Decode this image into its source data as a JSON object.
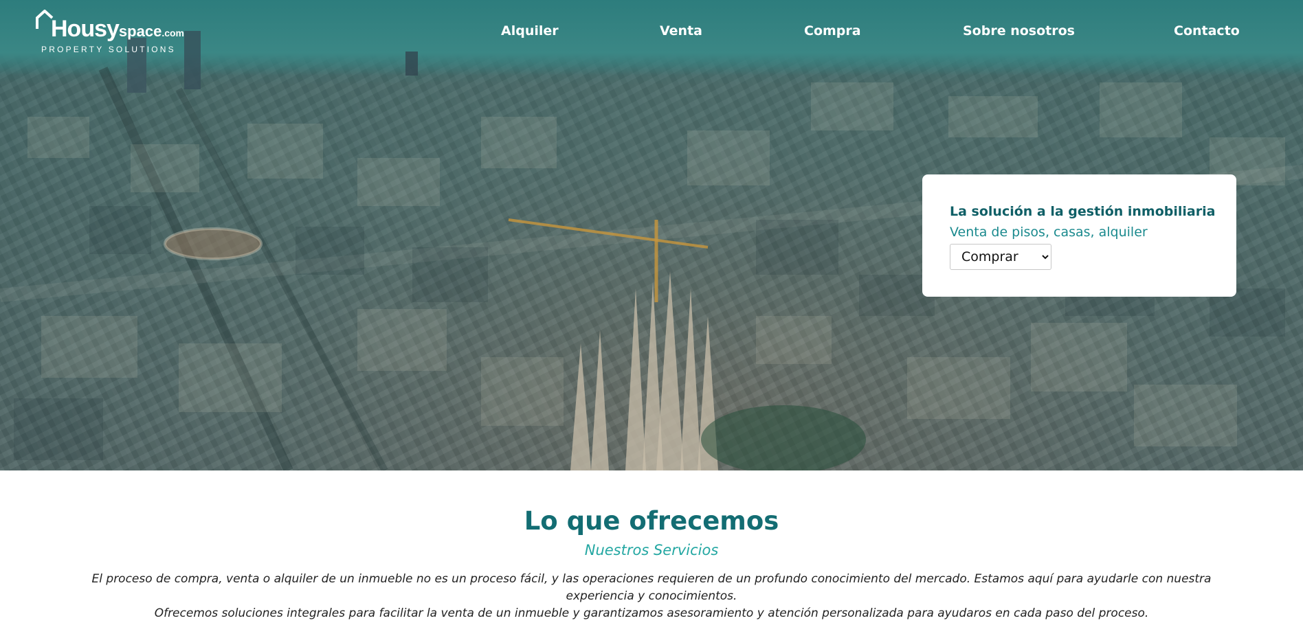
{
  "logo": {
    "brand_main": "Housy",
    "brand_space": "space",
    "brand_com": ".com",
    "tagline": "PROPERTY SOLUTIONS"
  },
  "nav": {
    "items": [
      "Alquiler",
      "Venta",
      "Compra",
      "Sobre nosotros",
      "Contacto"
    ]
  },
  "search_card": {
    "title": "La solución a la gestión inmobiliaria",
    "subtitle": "Venta de pisos, casas, alquiler",
    "select_value": "Comprar"
  },
  "offer": {
    "heading": "Lo que ofrecemos",
    "subheading": "Nuestros Servicios",
    "paragraph_1a": "El proceso de compra, venta o alquiler de un inmueble no es un proceso fácil, y las operaciones requieren de un profundo conocimiento del mercado. Estamos aquí para ayudarle con nuestra",
    "paragraph_1b": "experiencia y conocimientos.",
    "paragraph_2": "Ofrecemos soluciones integrales para facilitar la venta de un inmueble y garantizamos asesoramiento y atención personalizada para ayudaros en cada paso del proceso."
  },
  "colors": {
    "brand_dark_teal": "#136d73",
    "brand_teal": "#1b8a8e",
    "accent_aqua": "#23a7a2",
    "hero_overlay": "#2d7d7d"
  },
  "icons": {
    "logo_mark": "house-roof-icon",
    "select_chevron": "chevron-down-icon"
  }
}
